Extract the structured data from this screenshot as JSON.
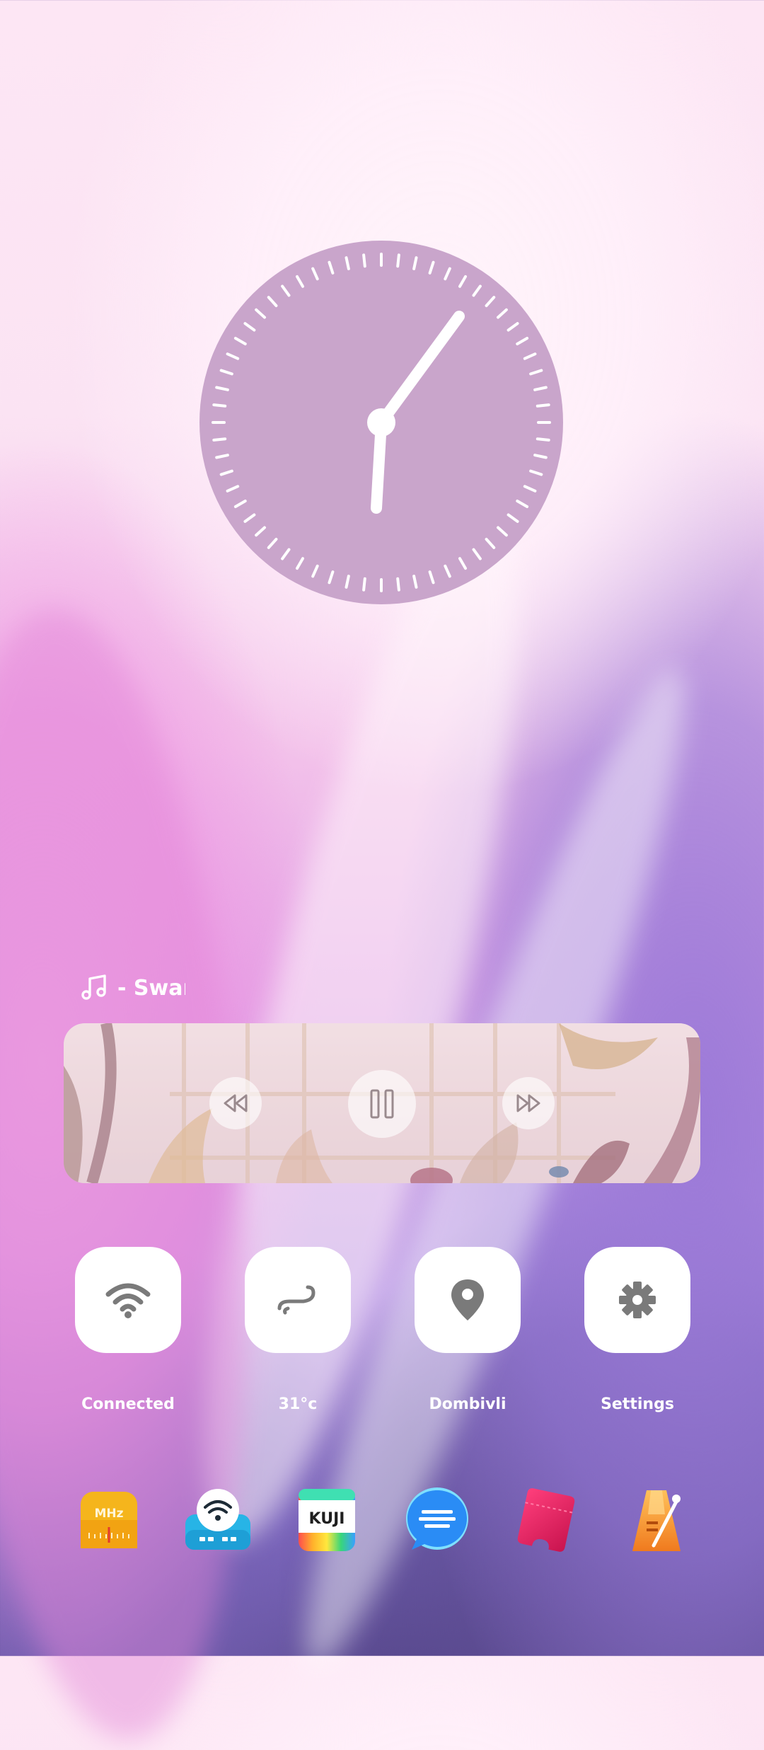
{
  "music": {
    "title": "- Swan"
  },
  "quick_tiles": [
    {
      "label": "Connected",
      "icon": "wifi-icon"
    },
    {
      "label": "31°c",
      "icon": "wind-icon"
    },
    {
      "label": "Dombivli",
      "icon": "location-pin-icon"
    },
    {
      "label": "Settings",
      "icon": "gear-icon"
    }
  ],
  "dock": {
    "apps": [
      {
        "icon": "radio-app-icon",
        "text": "MHz"
      },
      {
        "icon": "wifi-keyboard-app-icon"
      },
      {
        "icon": "kuji-app-icon",
        "text": "KUJI"
      },
      {
        "icon": "chat-app-icon"
      },
      {
        "icon": "ticket-app-icon"
      },
      {
        "icon": "metronome-app-icon"
      }
    ]
  },
  "colors": {
    "clock_face": "#c9a5cb",
    "tile_icon": "#7a7a7a",
    "text": "#ffffff"
  }
}
